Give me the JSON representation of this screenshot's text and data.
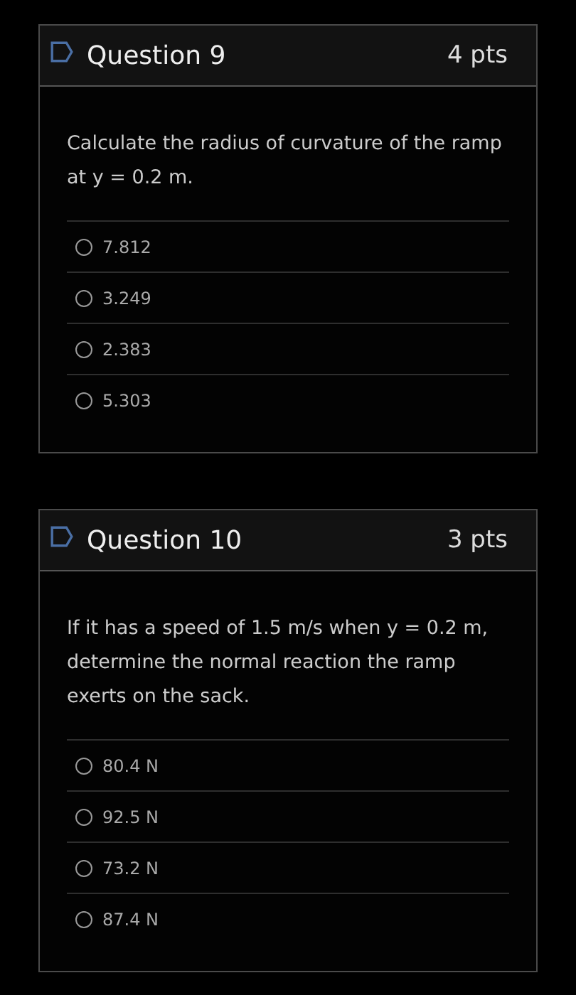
{
  "questions": [
    {
      "title": "Question 9",
      "points": "4 pts",
      "text": "Calculate the radius of curvature of the ramp at y = 0.2 m.",
      "options": [
        {
          "label": "7.812",
          "selected": false
        },
        {
          "label": "3.249",
          "selected": false
        },
        {
          "label": "2.383",
          "selected": false
        },
        {
          "label": "5.303",
          "selected": false
        }
      ]
    },
    {
      "title": "Question 10",
      "points": "3 pts",
      "text": "If it has a speed of 1.5 m/s when y = 0.2 m, determine the normal reaction the ramp exerts on the sack.",
      "options": [
        {
          "label": "80.4 N",
          "selected": false
        },
        {
          "label": "92.5 N",
          "selected": false
        },
        {
          "label": "73.2 N",
          "selected": false
        },
        {
          "label": "87.4 N",
          "selected": false
        }
      ]
    }
  ]
}
